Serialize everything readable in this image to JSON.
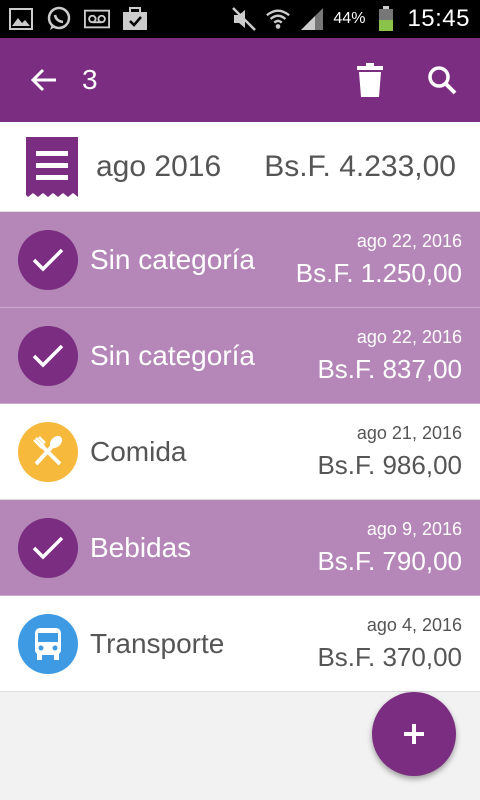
{
  "status_bar": {
    "battery_percent": "44%",
    "time": "15:45",
    "icons": [
      "image-icon",
      "whatsapp-icon",
      "voicemail-icon",
      "briefcase-icon",
      "mute-icon",
      "wifi-icon",
      "signal-icon",
      "battery-icon"
    ]
  },
  "app_bar": {
    "selected_count": "3",
    "background": "#7b2d82",
    "icons": [
      "back-arrow-icon",
      "trash-icon",
      "search-icon"
    ]
  },
  "summary": {
    "month": "ago 2016",
    "total": "Bs.F. 4.233,00",
    "icon": "receipt-icon"
  },
  "expenses": [
    {
      "category": "Sin categoría",
      "date": "ago 22, 2016",
      "amount": "Bs.F. 1.250,00",
      "selected": true,
      "icon": "check-icon"
    },
    {
      "category": "Sin categoría",
      "date": "ago 22, 2016",
      "amount": "Bs.F. 837,00",
      "selected": true,
      "icon": "check-icon"
    },
    {
      "category": "Comida",
      "date": "ago 21, 2016",
      "amount": "Bs.F. 986,00",
      "selected": false,
      "icon": "fork-spoon-icon",
      "color": "#f6b93b"
    },
    {
      "category": "Bebidas",
      "date": "ago 9, 2016",
      "amount": "Bs.F. 790,00",
      "selected": true,
      "icon": "check-icon"
    },
    {
      "category": "Transporte",
      "date": "ago 4, 2016",
      "amount": "Bs.F. 370,00",
      "selected": false,
      "icon": "bus-icon",
      "color": "#3d9ae3"
    }
  ],
  "colors": {
    "primary": "#7b2d82",
    "selected_row": "#b586b8"
  },
  "fab": {
    "icon": "plus-icon"
  }
}
